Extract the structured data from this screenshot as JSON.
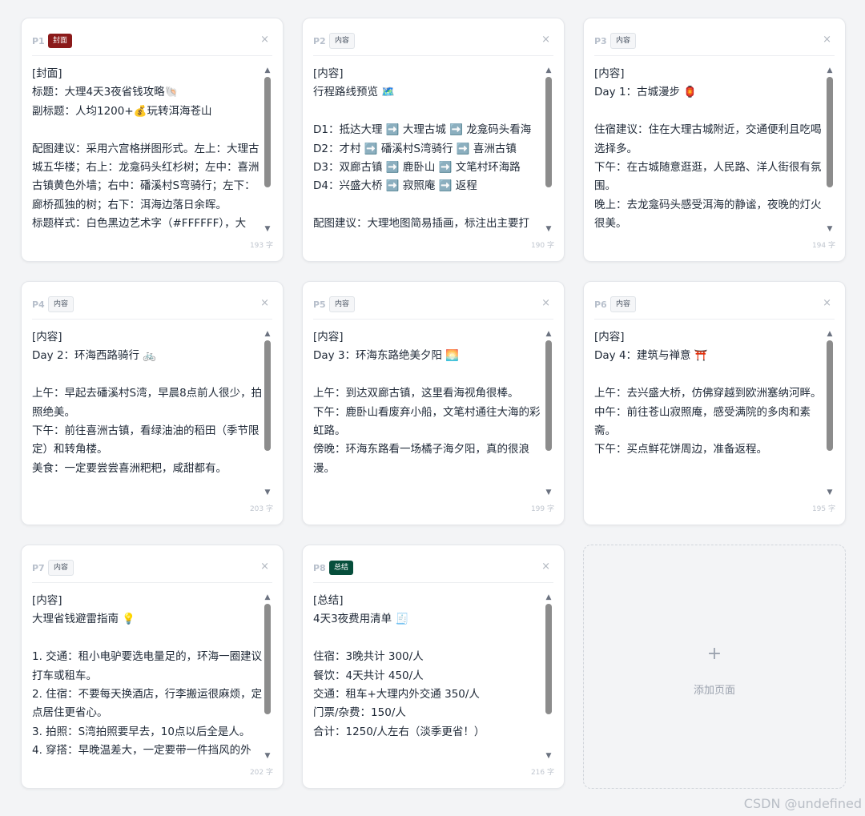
{
  "pages": [
    {
      "num": "P1",
      "tag": "封面",
      "tag_type": "cover",
      "body": "[封面]\n标题：大理4天3夜省钱攻略🐚\n副标题：人均1200+💰玩转洱海苍山\n\n配图建议：采用六宫格拼图形式。左上：大理古城五华楼；右上：龙龛码头红杉树；左中：喜洲古镇黄色外墙；右中：磻溪村S弯骑行；左下：廊桥孤独的树；右下：洱海边落日余晖。\n标题样式：白色黑边艺术字（#FFFFFF），大",
      "count": "193 字"
    },
    {
      "num": "P2",
      "tag": "内容",
      "tag_type": "content",
      "body": "[内容]\n行程路线预览 🗺️\n\nD1：抵达大理 ➡️ 大理古城 ➡️ 龙龛码头看海\nD2：才村 ➡️ 磻溪村S湾骑行 ➡️ 喜洲古镇\nD3：双廊古镇 ➡️ 鹿卧山 ➡️ 文笔村环海路\nD4：兴盛大桥 ➡️ 寂照庵 ➡️ 返程\n\n配图建议：大理地图简易插画，标注出主要打",
      "count": "190 字"
    },
    {
      "num": "P3",
      "tag": "内容",
      "tag_type": "content",
      "body": "[内容]\nDay 1：古城漫步 🏮\n\n住宿建议：住在大理古城附近，交通便利且吃喝选择多。\n下午：在古城随意逛逛，人民路、洋人街很有氛围。\n晚上：去龙龛码头感受洱海的静谧，夜晚的灯火很美。",
      "count": "194 字"
    },
    {
      "num": "P4",
      "tag": "内容",
      "tag_type": "content",
      "body": "[内容]\nDay 2：环海西路骑行 🚲\n\n上午：早起去磻溪村S湾，早晨8点前人很少，拍照绝美。\n下午：前往喜洲古镇，看绿油油的稻田（季节限定）和转角楼。\n美食：一定要尝尝喜洲粑粑，咸甜都有。",
      "count": "203 字"
    },
    {
      "num": "P5",
      "tag": "内容",
      "tag_type": "content",
      "body": "[内容]\nDay 3：环海东路绝美夕阳 🌅\n\n上午：到达双廊古镇，这里看海视角很棒。\n下午：鹿卧山看废弃小船，文笔村通往大海的彩虹路。\n傍晚：环海东路看一场橘子海夕阳，真的很浪漫。",
      "count": "199 字"
    },
    {
      "num": "P6",
      "tag": "内容",
      "tag_type": "content",
      "body": "[内容]\nDay 4：建筑与禅意 ⛩️\n\n上午：去兴盛大桥，仿佛穿越到欧洲塞纳河畔。\n中午：前往苍山寂照庵，感受满院的多肉和素斋。\n下午：买点鲜花饼周边，准备返程。",
      "count": "195 字"
    },
    {
      "num": "P7",
      "tag": "内容",
      "tag_type": "content",
      "body": "[内容]\n大理省钱避雷指南 💡\n\n1. 交通：租小电驴要选电量足的，环海一圈建议打车或租车。\n2. 住宿：不要每天换酒店，行李搬运很麻烦，定点居住更省心。\n3. 拍照：S湾拍照要早去，10点以后全是人。\n4. 穿搭：早晚温差大，一定要带一件挡风的外",
      "count": "202 字"
    },
    {
      "num": "P8",
      "tag": "总结",
      "tag_type": "summary",
      "body": "[总结]\n4天3夜费用清单 🧾\n\n住宿：3晚共计 300/人\n餐饮：4天共计 450/人\n交通：租车+大理内外交通 350/人\n门票/杂费：150/人\n合计：1250/人左右（淡季更省！）",
      "count": "216 字"
    }
  ],
  "add_page": {
    "icon": "+",
    "label": "添加页面"
  },
  "close_glyph": "×",
  "scroll_up_glyph": "▲",
  "scroll_down_glyph": "▼",
  "watermark": "CSDN @undefined",
  "colors": {
    "cover_tag": "#8b1a1a",
    "summary_tag": "#064e3b",
    "background": "#f3f4f6"
  }
}
